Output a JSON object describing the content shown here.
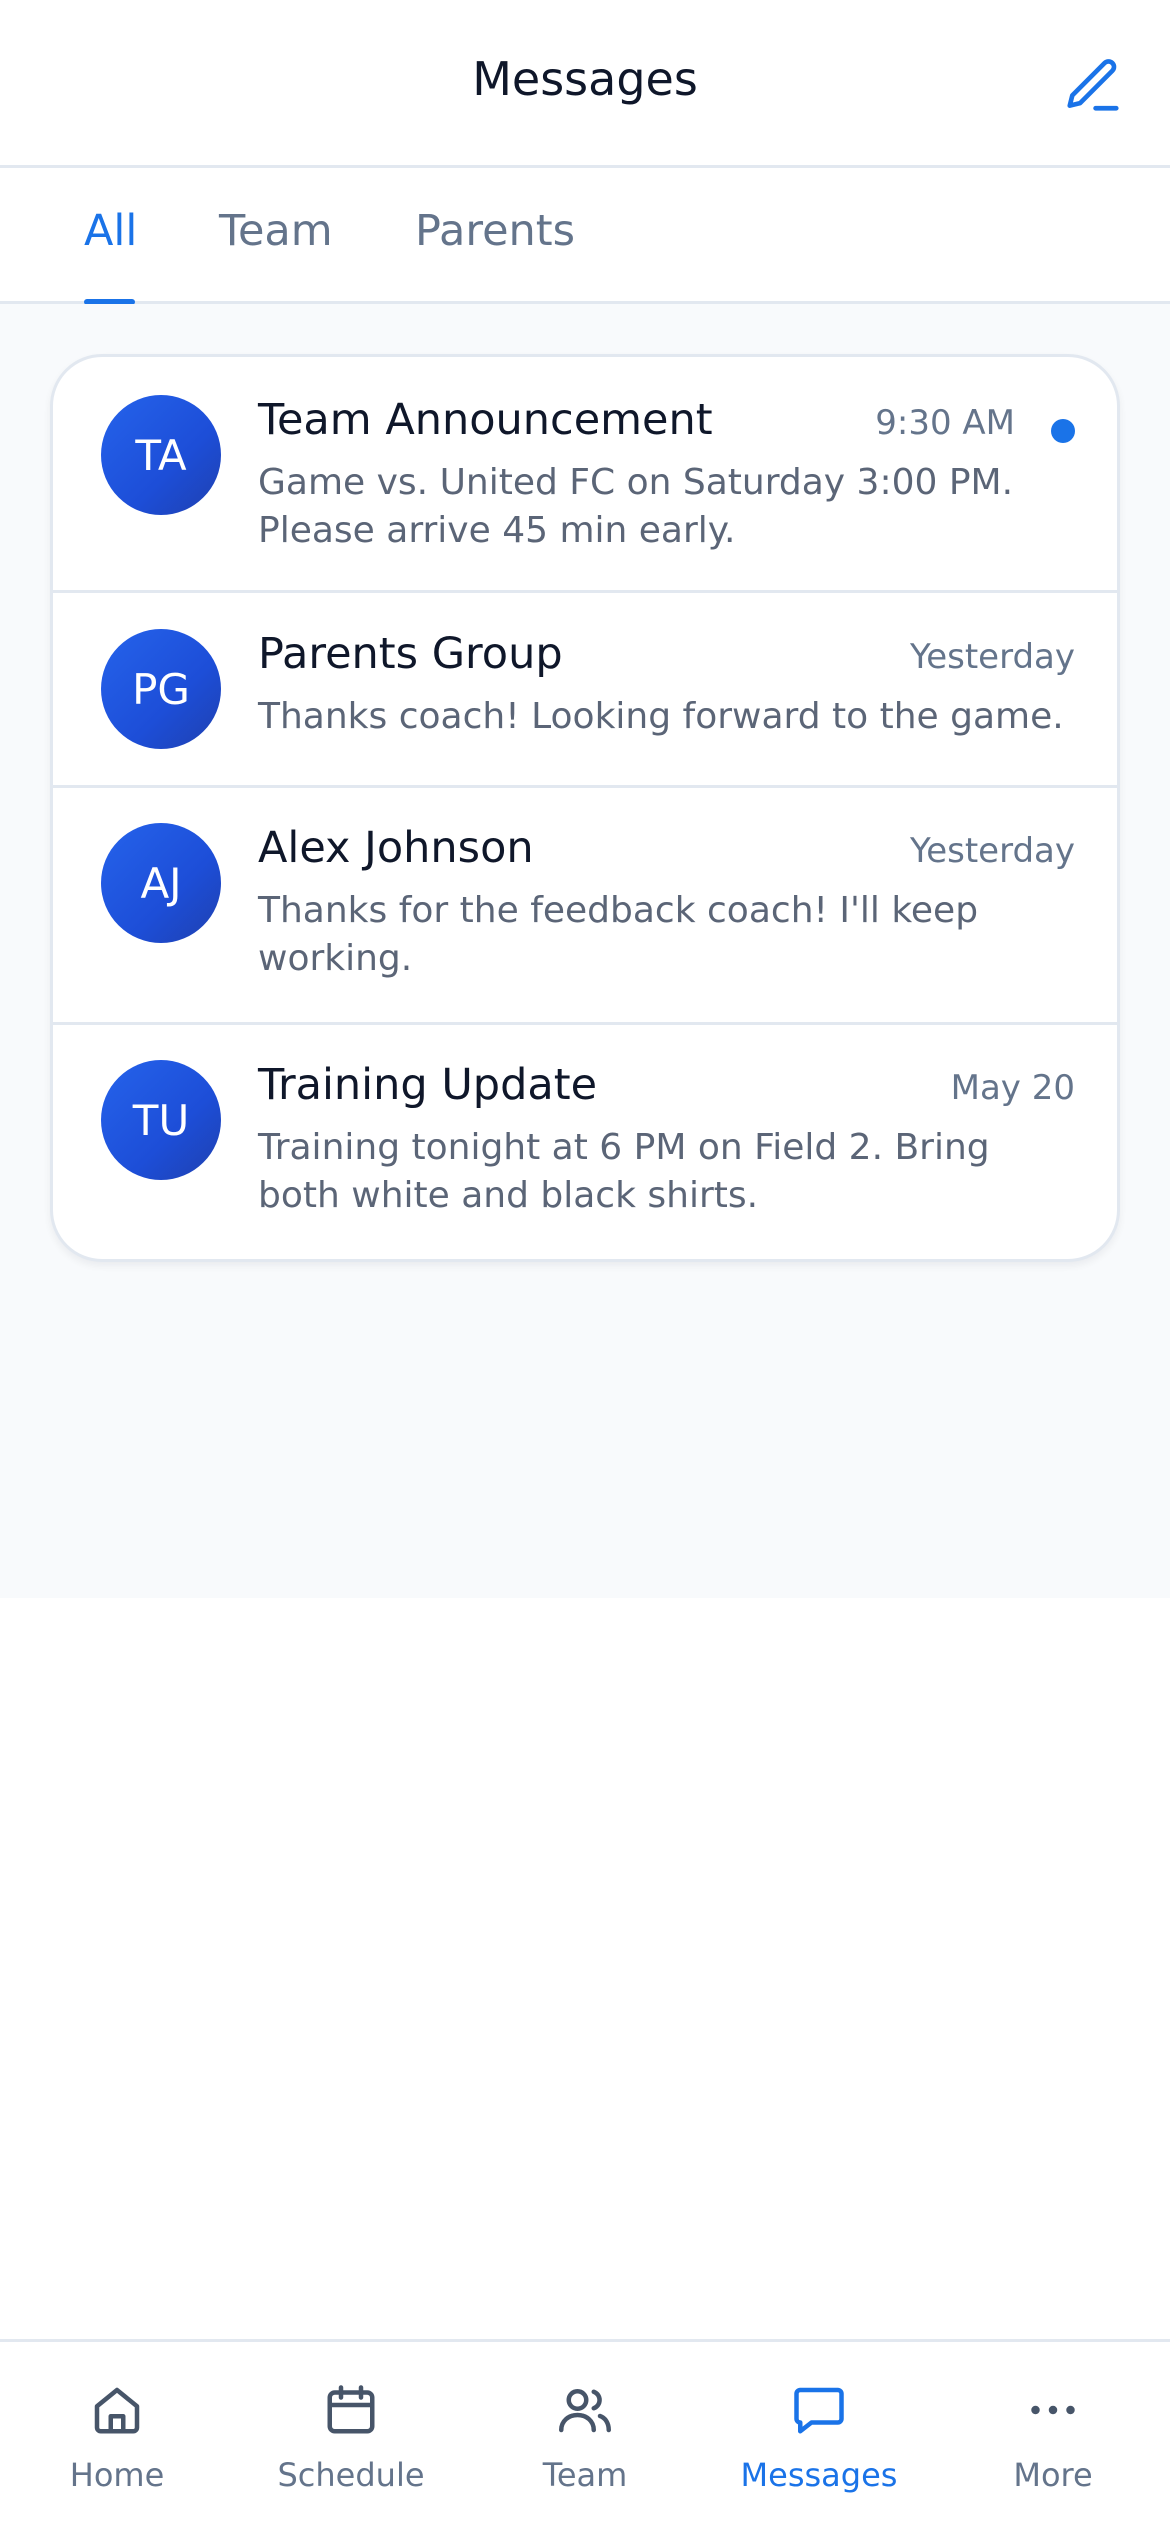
{
  "header": {
    "title": "Messages",
    "compose_icon": "pencil-icon"
  },
  "tabs": [
    {
      "label": "All",
      "active": true
    },
    {
      "label": "Team",
      "active": false
    },
    {
      "label": "Parents",
      "active": false
    }
  ],
  "conversations": [
    {
      "initials": "TA",
      "name": "Team Announcement",
      "time": "9:30 AM",
      "preview": "Game vs. United FC on Saturday 3:00 PM. Please arrive 45 min early.",
      "unread": true
    },
    {
      "initials": "PG",
      "name": "Parents Group",
      "time": "Yesterday",
      "preview": "Thanks coach! Looking forward to the game.",
      "unread": false
    },
    {
      "initials": "AJ",
      "name": "Alex Johnson",
      "time": "Yesterday",
      "preview": "Thanks for the feedback coach! I'll keep working.",
      "unread": false
    },
    {
      "initials": "TU",
      "name": "Training Update",
      "time": "May 20",
      "preview": "Training tonight at 6 PM on Field 2. Bring both white and black shirts.",
      "unread": false
    }
  ],
  "nav": [
    {
      "label": "Home",
      "icon": "home-icon",
      "active": false
    },
    {
      "label": "Schedule",
      "icon": "calendar-icon",
      "active": false
    },
    {
      "label": "Team",
      "icon": "users-icon",
      "active": false
    },
    {
      "label": "Messages",
      "icon": "message-icon",
      "active": true
    },
    {
      "label": "More",
      "icon": "more-icon",
      "active": false
    }
  ],
  "colors": {
    "accent": "#1a73e8",
    "avatar": "#1d4ed8",
    "muted_text": "#64748b",
    "background": "#f8fafc"
  }
}
